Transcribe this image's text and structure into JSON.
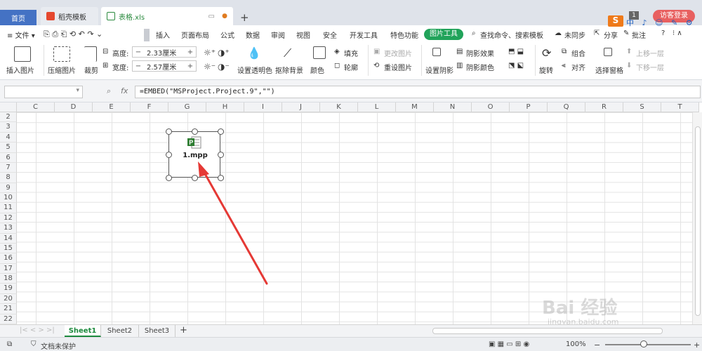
{
  "tabs": {
    "home": "首页",
    "docer": "稻壳模板",
    "file": "表格.xls",
    "new_tab": "+"
  },
  "topright": {
    "sogou": "S",
    "ime": "中 ♪ ☺ ✎ ⚙ ⁝",
    "page_count": "1",
    "visitor": "访客登录"
  },
  "menubar": {
    "file": "≡ 文件 ▾",
    "items": [
      "插入",
      "页面布局",
      "公式",
      "数据",
      "审阅",
      "视图",
      "安全",
      "开发工具",
      "特色功能"
    ],
    "picture_tools": "图片工具",
    "search": "查找命令、搜索模板",
    "sync": "未同步",
    "share": "分享",
    "annotate": "批注",
    "help": "?"
  },
  "ribbon": {
    "insert_picture": "插入图片",
    "compress_picture": "压缩图片",
    "crop": "裁剪",
    "height_label": "高度:",
    "height_value": "2.33厘米",
    "width_label": "宽度:",
    "width_value": "2.57厘米",
    "set_transparent": "设置透明色",
    "remove_bg": "抠除背景",
    "color": "颜色",
    "fill": "填充",
    "outline": "轮廓",
    "change_picture": "更改图片",
    "reset_picture": "重设图片",
    "set_shadow": "设置阴影",
    "shadow_effect": "阴影效果",
    "shadow_color": "阴影颜色",
    "rotate": "旋转",
    "group": "组合",
    "align": "对齐",
    "select_pane": "选择窗格",
    "bring_forward": "上移一层",
    "send_backward": "下移一层"
  },
  "formula_bar": {
    "fx": "fx",
    "formula": "=EMBED(\"MSProject.Project.9\",\"\")"
  },
  "grid": {
    "columns": [
      "C",
      "D",
      "E",
      "F",
      "G",
      "H",
      "I",
      "J",
      "K",
      "L",
      "M",
      "N",
      "O",
      "P",
      "Q",
      "R",
      "S",
      "T"
    ],
    "rows": [
      "2",
      "3",
      "4",
      "5",
      "6",
      "7",
      "8",
      "9",
      "10",
      "11",
      "12",
      "13",
      "14",
      "15",
      "16",
      "17",
      "18",
      "19",
      "20",
      "21",
      "22"
    ]
  },
  "embedded_object": {
    "label": "1.mpp",
    "icon_letter": "P"
  },
  "sheets": [
    "Sheet1",
    "Sheet2",
    "Sheet3"
  ],
  "add_sheet": "+",
  "status": {
    "protect": "文档未保护",
    "zoom": "100%",
    "zoom_minus": "−",
    "zoom_plus": "+"
  },
  "watermark": {
    "main": "Bai 经验",
    "sub": "jingyan.baidu.com"
  },
  "colors": {
    "accent_green": "#21a35a",
    "home_tab": "#4472c4",
    "arrow": "#e53935"
  }
}
